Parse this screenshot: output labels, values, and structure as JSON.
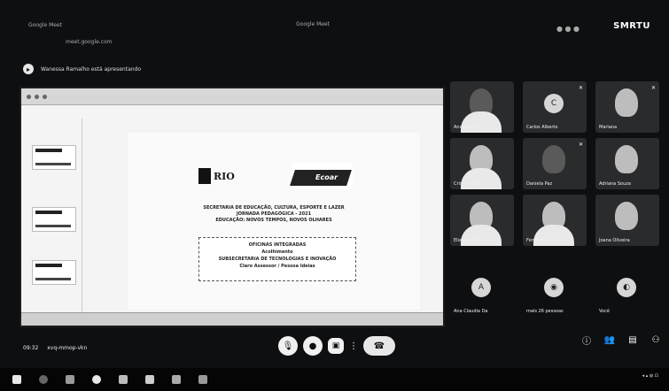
{
  "browser": {
    "tab_label": "Google Meet",
    "center_title": "Google Meet",
    "url": "meet.google.com",
    "corner_text": "SMRTU"
  },
  "presenting_label": "Wanessa Ramalho está apresentando",
  "slide": {
    "logo_left": "RIO",
    "logo_right": "Ecoar",
    "heading_lines": [
      "SECRETARIA DE EDUCAÇÃO, CULTURA, ESPORTE E LAZER",
      "JORNADA PEDAGÓGICA - 2021",
      "EDUCAÇÃO: NOVOS TEMPOS, NOVOS OLHARES"
    ],
    "box_lines": [
      "OFICINAS INTEGRADAS",
      "Acolhimento",
      "SUBSECRETARIA DE TECNOLOGIAS E INOVAÇÃO",
      "Claro Assessor / Pessoa Ideias"
    ]
  },
  "participants": [
    {
      "name": "Ana Claudia"
    },
    {
      "name": "Carlos Alberto",
      "initial": "C"
    },
    {
      "name": "Mariana"
    },
    {
      "name": "Cristina Dias"
    },
    {
      "name": "Daniela Paz"
    },
    {
      "name": "Adriana Souza"
    },
    {
      "name": "Eliane Lima"
    },
    {
      "name": "Fernanda Rocha"
    },
    {
      "name": "Joana Oliveira"
    },
    {
      "name": "Ana Claudia Da",
      "initial": "A"
    },
    {
      "name": "mais 26 pessoas"
    },
    {
      "name": "Você"
    }
  ],
  "meeting": {
    "time": "09:32",
    "code": "xvq-mmop-vkn"
  }
}
